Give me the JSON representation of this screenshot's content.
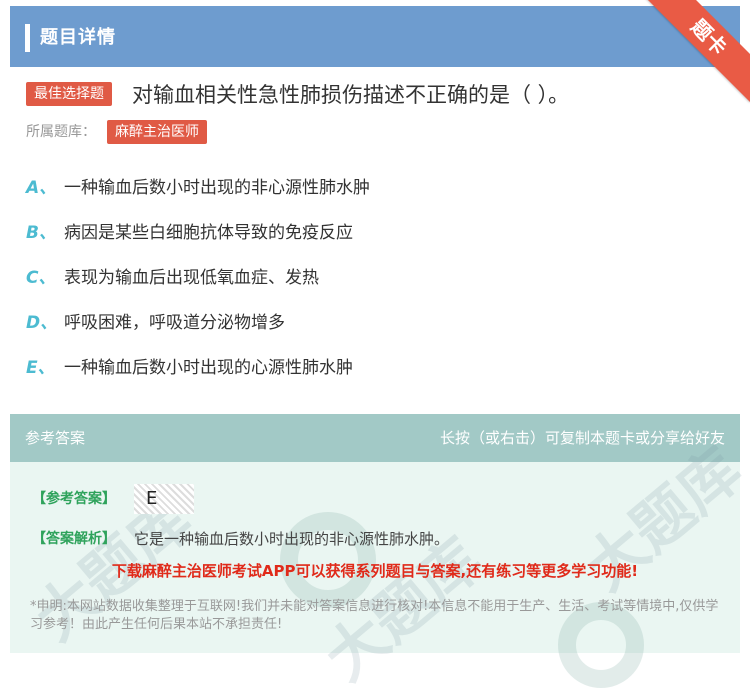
{
  "header": {
    "title": "题目详情"
  },
  "ribbon": {
    "label": "题卡"
  },
  "question": {
    "tag": "最佳选择题",
    "text": "对输血相关性急性肺损伤描述不正确的是（ ）。",
    "bank_label": "所属题库：",
    "bank_name": "麻醉主治医师"
  },
  "options": [
    {
      "letter": "A、",
      "text": "一种输血后数小时出现的非心源性肺水肿"
    },
    {
      "letter": "B、",
      "text": "病因是某些白细胞抗体导致的免疫反应"
    },
    {
      "letter": "C、",
      "text": "表现为输血后出现低氧血症、发热"
    },
    {
      "letter": "D、",
      "text": "呼吸困难，呼吸道分泌物增多"
    },
    {
      "letter": "E、",
      "text": "一种输血后数小时出现的心源性肺水肿"
    }
  ],
  "answer_section": {
    "header_left": "参考答案",
    "header_right": "长按（或右击）可复制本题卡或分享给好友",
    "answer_label": "【参考答案】",
    "answer_value": "E",
    "analysis_label": "【答案解析】",
    "analysis_text": "它是一种输血后数小时出现的非心源性肺水肿。",
    "promo": "下载麻醉主治医师考试APP可以获得系列题目与答案,还有练习等更多学习功能!",
    "disclaimer": "*申明:本网站数据收集整理于互联网!我们并未能对答案信息进行核对!本信息不能用于生产、生活、考试等情境中,仅供学习参考！由此产生任何后果本站不承担责任!"
  },
  "watermark": {
    "text": "大题库"
  },
  "colors": {
    "header_bg": "#6e9ccf",
    "tag_red": "#e05a45",
    "option_letter": "#4cbbd1",
    "answer_header_bg": "#a2c9c6",
    "answer_body_bg": "#eaf6f2",
    "answer_label_green": "#2fa35c",
    "promo_red": "#e02a1a"
  }
}
